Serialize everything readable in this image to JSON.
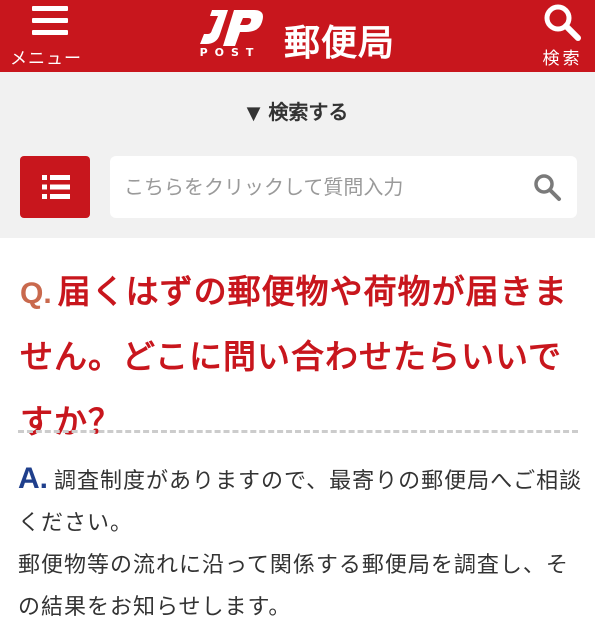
{
  "header": {
    "menu_label": "メニュー",
    "logo_text": "JP",
    "logo_sub": "POST",
    "title": "郵便局",
    "search_label": "検索",
    "bg_color": "#c8161d"
  },
  "search": {
    "toggle_label": "検索する",
    "toggle_icon": "triangle-down-icon",
    "placeholder": "こちらをクリックして質問入力",
    "list_icon": "list-icon",
    "submit_icon": "search-icon"
  },
  "question": {
    "label": "Q.",
    "text": "届くはずの郵便物や荷物が届きません。どこに問い合わせたらいいですか？"
  },
  "answer": {
    "label": "A.",
    "line1": "調査制度がありますので、最寄りの郵便局へご相談ください。",
    "line2": "郵便物等の流れに沿って関係する郵便局を調査し、その結果をお知らせします。"
  }
}
